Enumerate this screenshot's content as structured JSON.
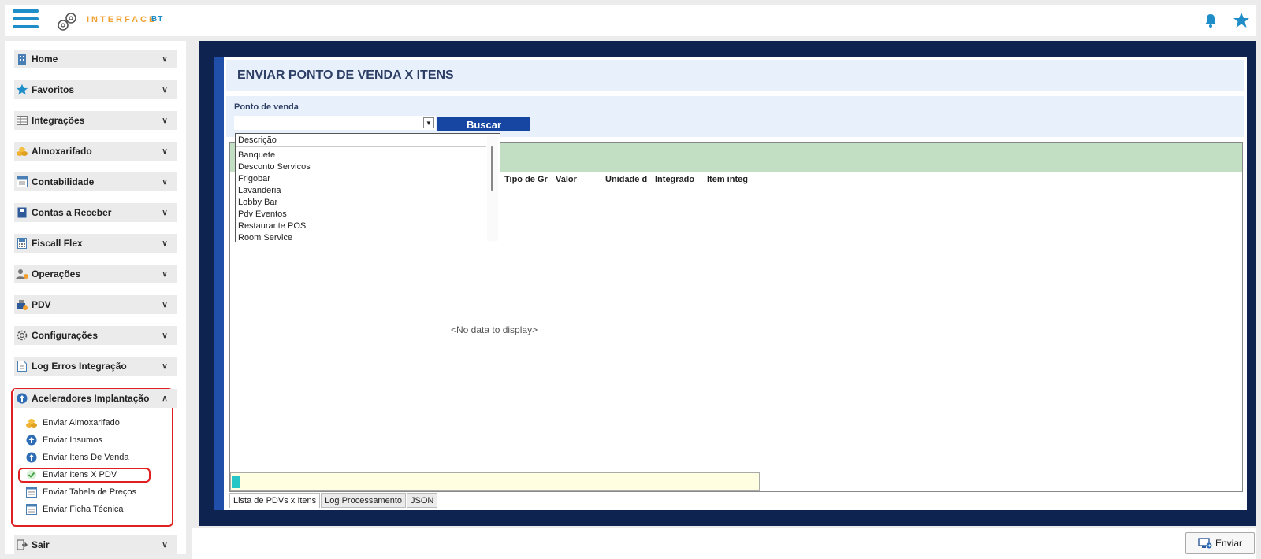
{
  "app": {
    "logo_text": "INTERFACE",
    "logo_suffix": "BT"
  },
  "sidebar": {
    "items": [
      {
        "label": "Home",
        "icon": "building-icon"
      },
      {
        "label": "Favoritos",
        "icon": "star-icon"
      },
      {
        "label": "Integrações",
        "icon": "table-icon"
      },
      {
        "label": "Almoxarifado",
        "icon": "coins-icon"
      },
      {
        "label": "Contabilidade",
        "icon": "ledger-icon"
      },
      {
        "label": "Contas a Receber",
        "icon": "book-icon"
      },
      {
        "label": "Fiscall Flex",
        "icon": "calculator-icon"
      },
      {
        "label": "Operações",
        "icon": "user-gear-icon"
      },
      {
        "label": "PDV",
        "icon": "pos-icon"
      },
      {
        "label": "Configurações",
        "icon": "gear-icon"
      },
      {
        "label": "Log Erros Integração",
        "icon": "document-icon"
      },
      {
        "label": "Aceleradores Implantação",
        "icon": "arrow-up-circle-icon"
      },
      {
        "label": "Sair",
        "icon": "exit-icon"
      }
    ],
    "subitems": [
      {
        "label": "Enviar Almoxarifado",
        "icon": "coins-icon"
      },
      {
        "label": "Enviar Insumos",
        "icon": "arrow-up-circle-icon"
      },
      {
        "label": "Enviar Itens De Venda",
        "icon": "arrow-up-circle-icon"
      },
      {
        "label": "Enviar Itens X PDV",
        "icon": "check-circle-icon"
      },
      {
        "label": "Enviar Tabela de Preços",
        "icon": "ledger-icon"
      },
      {
        "label": "Enviar Ficha Técnica",
        "icon": "ledger-icon"
      }
    ]
  },
  "main": {
    "title": "ENVIAR PONTO DE VENDA X ITENS",
    "filter_label": "Ponto de venda",
    "combo_value": "",
    "search_button": "Buscar",
    "grid_columns": [
      "Tipo de Gr",
      "Valor",
      "Unidade d",
      "Integrado",
      "Item integ"
    ],
    "no_data": "<No data to display>",
    "tabs": [
      "Lista de PDVs x Itens",
      "Log Processamento",
      "JSON"
    ]
  },
  "dropdown": {
    "header": "Descrição",
    "items": [
      "Banquete",
      "Desconto Servicos",
      "Frigobar",
      "Lavanderia",
      "Lobby Bar",
      "Pdv Eventos",
      "Restaurante POS",
      "Room Service"
    ]
  },
  "footer": {
    "send_button": "Enviar"
  },
  "colors": {
    "accent": "#1e8dc8",
    "frame": "#0f2350",
    "button_blue": "#1746a2",
    "highlight_red": "#e02020",
    "grid_green": "#c2dfc4"
  }
}
